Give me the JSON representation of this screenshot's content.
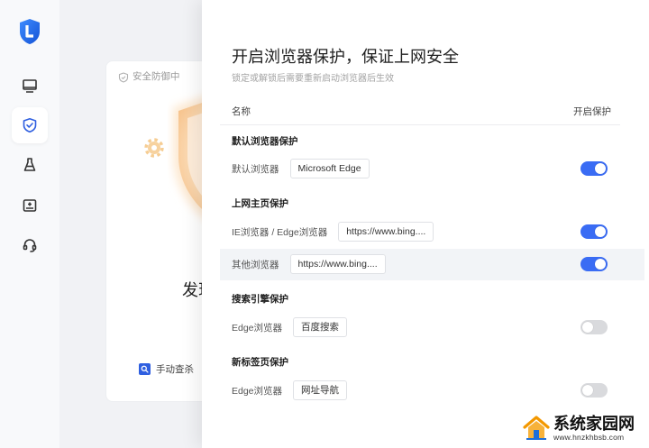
{
  "sidebar": {
    "logo_icon": "shield-logo-icon",
    "items": [
      {
        "icon": "monitor-icon",
        "active": false
      },
      {
        "icon": "shield-check-icon",
        "active": true
      },
      {
        "icon": "clean-brush-icon",
        "active": false
      },
      {
        "icon": "toolbox-icon",
        "active": false
      },
      {
        "icon": "headset-icon",
        "active": false
      }
    ]
  },
  "status_card": {
    "status_icon": "shield-outline-icon",
    "status_label": "安全防御中",
    "headline": "发现",
    "manual_scan_icon": "magnifier-icon",
    "manual_scan_label": "手动查杀"
  },
  "panel": {
    "title": "开启浏览器保护，保证上网安全",
    "subtitle": "锁定或解锁后需要重新启动浏览器后生效",
    "header": {
      "name": "名称",
      "protect": "开启保护"
    },
    "sections": [
      {
        "title": "默认浏览器保护",
        "rows": [
          {
            "label": "默认浏览器",
            "value": "Microsoft Edge",
            "enabled": true
          }
        ]
      },
      {
        "title": "上网主页保护",
        "rows": [
          {
            "label": "IE浏览器 / Edge浏览器",
            "value": "https://www.bing....",
            "enabled": true
          },
          {
            "label": "其他浏览器",
            "value": "https://www.bing....",
            "enabled": true
          }
        ]
      },
      {
        "title": "搜索引擎保护",
        "rows": [
          {
            "label": "Edge浏览器",
            "value": "百度搜索",
            "enabled": false
          }
        ]
      },
      {
        "title": "新标签页保护",
        "rows": [
          {
            "label": "Edge浏览器",
            "value": "网址导航",
            "enabled": false
          }
        ]
      }
    ]
  },
  "colors": {
    "accent": "#3a6cf4",
    "toggle_off": "#d9dadd",
    "highlight_row": "#f2f4f7",
    "brand_blue": "#2f5fe0"
  },
  "watermark": {
    "logo_icon": "house-logo-icon",
    "name": "系统家园网",
    "url": "www.hnzkhbsb.com"
  }
}
